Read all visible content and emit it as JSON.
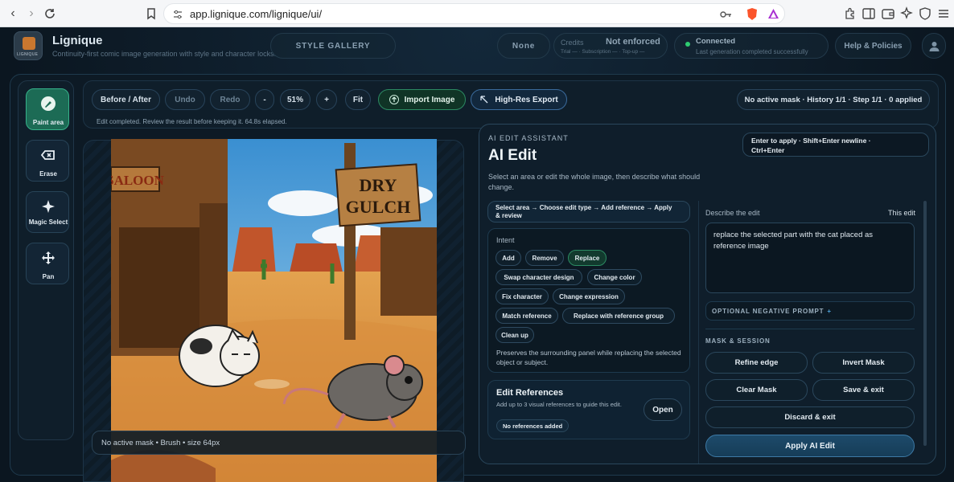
{
  "browser": {
    "url": "app.lignique.com/lignique/ui/"
  },
  "header": {
    "logo_text": "LIGNIQUE",
    "brand": "Lignique",
    "tagline": "Continuity-first comic image generation with style and character locks.",
    "style_gallery": "STYLE GALLERY",
    "none_label": "None",
    "credits_label": "Credits",
    "credits_value": "Not enforced",
    "credits_sub": "Trial — · Subscription — · Top-up —",
    "connection_title": "Connected",
    "connection_sub": "Last generation completed successfully",
    "help": "Help & Policies"
  },
  "tools": [
    {
      "label": "Paint area",
      "icon": "brush-icon",
      "active": true
    },
    {
      "label": "Erase",
      "icon": "eraser-icon",
      "active": false
    },
    {
      "label": "Magic Select",
      "icon": "sparkle-icon",
      "active": false
    },
    {
      "label": "Pan",
      "icon": "move-icon",
      "active": false
    }
  ],
  "toolbar": {
    "before_after": "Before / After",
    "undo": "Undo",
    "redo": "Redo",
    "zoom_out": "-",
    "zoom": "51%",
    "zoom_in": "+",
    "fit": "Fit",
    "import": "Import Image",
    "export": "High-Res Export",
    "status": "No active mask · History 1/1 · Step 1/1 · 0 applied",
    "edit_status": "Edit completed. Review the result before keeping it. 64.8s elapsed."
  },
  "canvas": {
    "mask_status": "No active mask • Brush • size 64px",
    "sign_saloon": "SALOON",
    "sign_town_1": "DRY",
    "sign_town_2": "GULCH"
  },
  "panel": {
    "eyebrow": "AI EDIT ASSISTANT",
    "title": "AI Edit",
    "description": "Select an area or edit the whole image, then describe what should change.",
    "shortcut_1": "Enter to apply · Shift+Enter newline ·",
    "shortcut_2": "Ctrl+Enter",
    "flow_1": "Select area → Choose edit type → Add reference → Apply",
    "flow_2": "& review",
    "intent_label": "Intent",
    "intents": [
      "Add",
      "Remove",
      "Replace",
      "Swap character design",
      "Change color",
      "Fix character",
      "Change expression",
      "Match reference",
      "Replace with reference group",
      "Clean up"
    ],
    "selected_intent": "Replace",
    "intent_hint": "Preserves the surrounding panel while replacing the selected object or subject.",
    "refs_title": "Edit References",
    "refs_desc": "Add up to 3 visual references to guide this edit.",
    "refs_none": "No references added",
    "refs_open": "Open",
    "describe_label": "Describe the edit",
    "this_edit": "This edit",
    "prompt_value": "replace the selected part with the cat placed as reference image",
    "negative_label": "OPTIONAL NEGATIVE PROMPT",
    "negative_plus": "+",
    "mask_session": "MASK & SESSION",
    "refine_edge": "Refine edge",
    "invert_mask": "Invert Mask",
    "clear_mask": "Clear Mask",
    "save_exit": "Save & exit",
    "discard_exit": "Discard & exit",
    "apply": "Apply AI Edit"
  }
}
